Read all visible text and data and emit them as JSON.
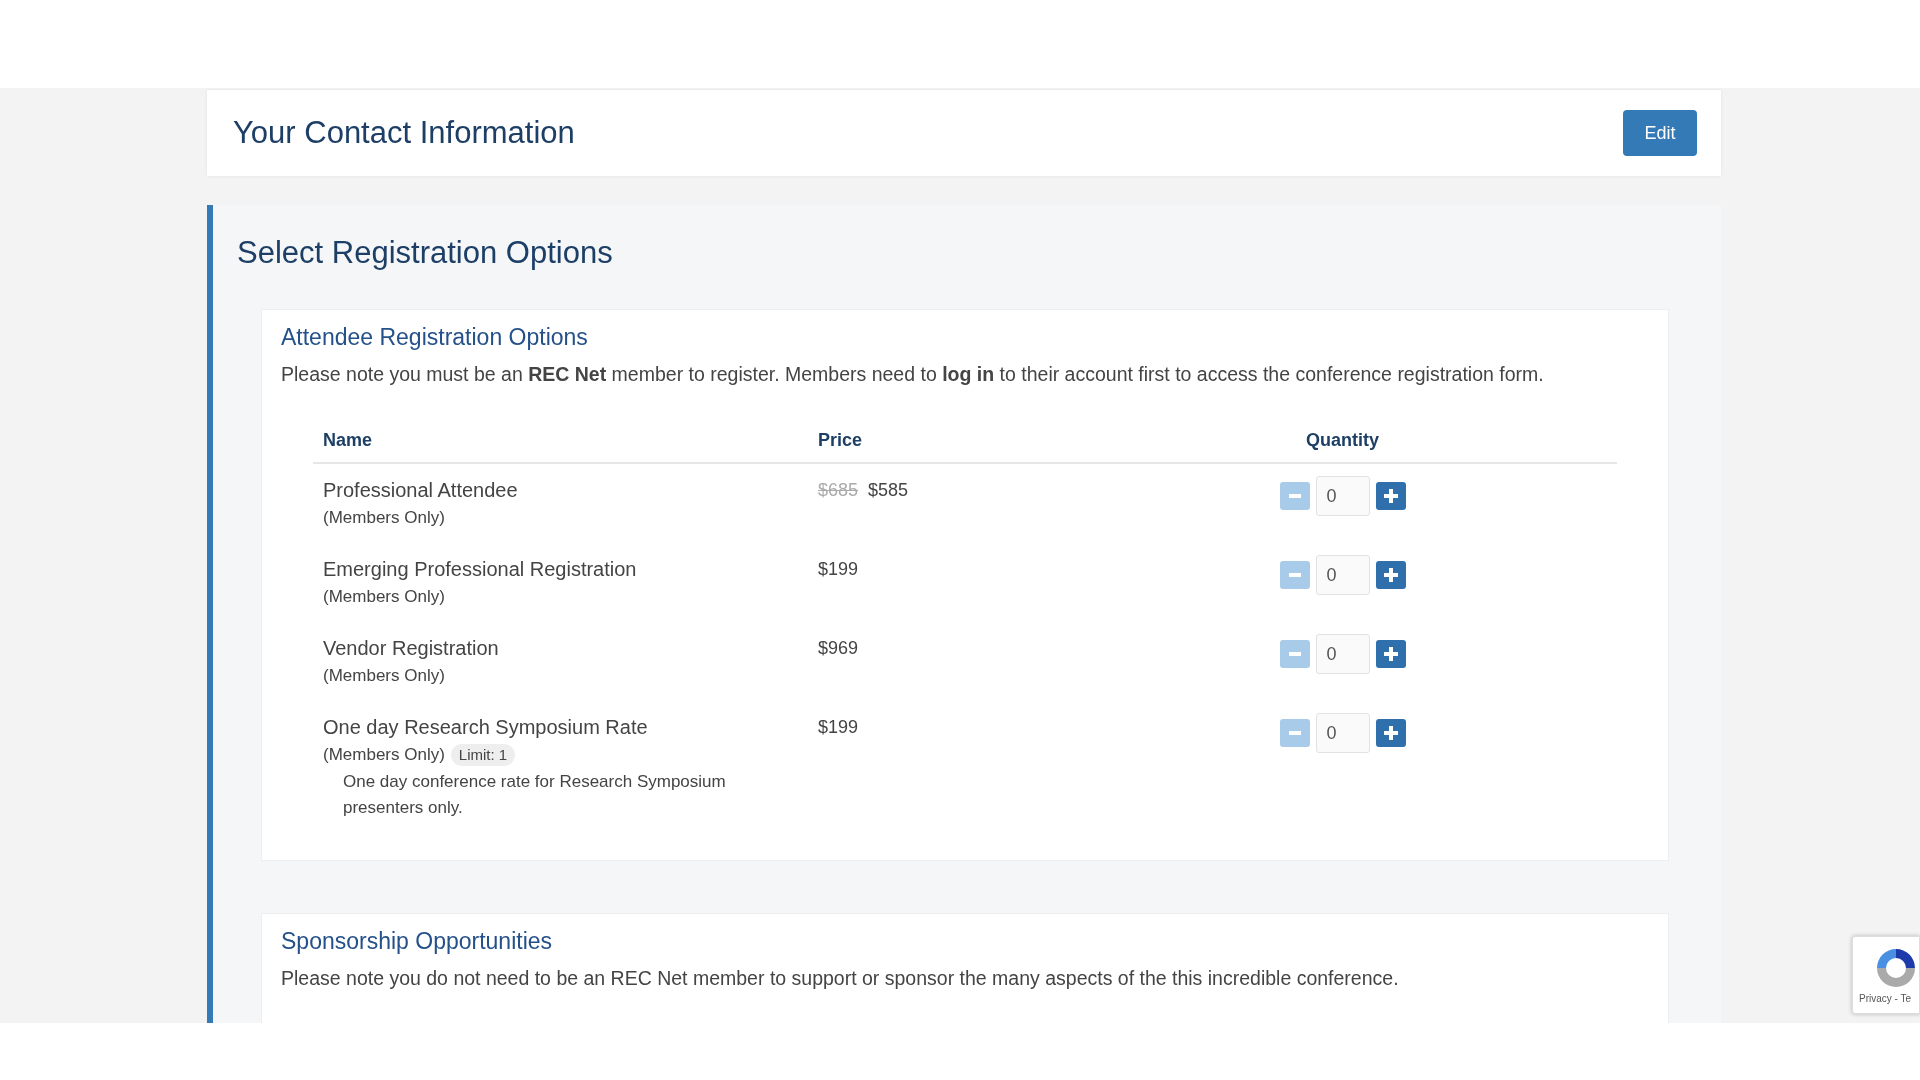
{
  "contact": {
    "title": "Your Contact Information",
    "edit_button": "Edit"
  },
  "registration": {
    "title": "Select Registration Options",
    "attendee": {
      "heading": "Attendee Registration Options",
      "note": "Please note you must be an **REC Net** member to register. Members need to **log in** to their account first to access the conference registration form.",
      "columns": [
        "Name",
        "Price",
        "Quantity"
      ],
      "rows": [
        {
          "name": "Professional Attendee",
          "sub": "(Members Only)",
          "old_price": "$685",
          "price": "$585",
          "quantity": "0",
          "decrease_disabled": true
        },
        {
          "name": "Emerging Professional Registration",
          "sub": "(Members Only)",
          "price": "$199",
          "quantity": "0",
          "decrease_disabled": true
        },
        {
          "name": "Vendor Registration",
          "sub": "(Members Only)",
          "price": "$969",
          "quantity": "0",
          "decrease_disabled": true
        },
        {
          "name": "One day Research Symposium Rate",
          "sub": "(Members Only)",
          "badge": "Limit: 1",
          "description": "One day conference rate for Research Symposium presenters only.",
          "price": "$199",
          "quantity": "0",
          "decrease_disabled": true
        }
      ]
    },
    "sponsorship": {
      "heading": "Sponsorship Opportunities",
      "note": "Please note you do not need to be an REC Net member to support or sponsor the many aspects of the this incredible conference."
    }
  },
  "recaptcha": {
    "text": "Privacy - Te"
  }
}
